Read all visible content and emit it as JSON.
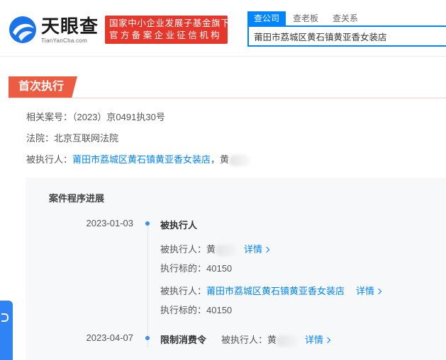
{
  "header": {
    "logo_cn": "天眼查",
    "logo_en": "TianYanCha.com",
    "gov_badge_line1": "国家中小企业发展子基金旗下",
    "gov_badge_line2": "官方备案企业征信机构",
    "brand_color": "#0084ff",
    "badge_color": "#e5372b"
  },
  "search": {
    "tabs": [
      {
        "label": "查公司",
        "active": true
      },
      {
        "label": "查老板",
        "active": false
      },
      {
        "label": "查关系",
        "active": false
      }
    ],
    "value": "莆田市荔城区黄石镇黄亚香女装店"
  },
  "section": {
    "tag": "首次执行",
    "tag_color": "#ec5c42"
  },
  "info": {
    "case_label": "相关案号：",
    "case_value": "（2023）京0491执30号",
    "court_label": "法院：",
    "court_value": "北京互联网法院",
    "executed_label": "被执行人：",
    "executed_company": "莆田市荔城区黄石镇黄亚香女装店",
    "executed_sep": "，",
    "executed_person": "黄"
  },
  "progress": {
    "title": "案件程序进展",
    "events": [
      {
        "date": "2023-01-03",
        "title": "被执行人",
        "entries": [
          {
            "label": "被执行人：",
            "name": "黄",
            "detail": "详情",
            "target_label": "执行标的：",
            "target_value": "40150"
          },
          {
            "label": "被执行人：",
            "name": "莆田市荔城区黄石镇黄亚香女装店",
            "detail": "详情",
            "target_label": "执行标的：",
            "target_value": "40150"
          }
        ]
      },
      {
        "date": "2023-04-07",
        "title": "限制消费令",
        "entries": [
          {
            "label": "被执行人：",
            "name": "黄",
            "detail": "详情"
          }
        ]
      }
    ]
  }
}
